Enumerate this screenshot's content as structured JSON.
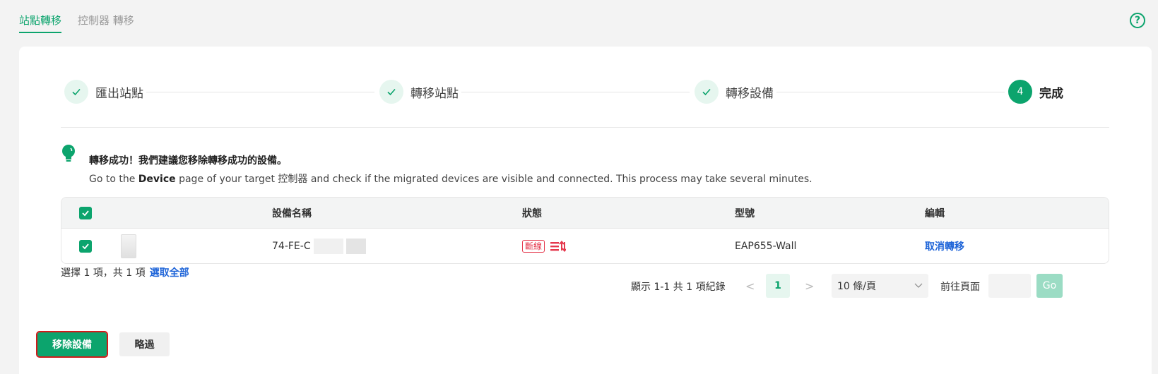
{
  "tabs": [
    {
      "label": "站點轉移",
      "active": true
    },
    {
      "label": "控制器 轉移",
      "active": false
    }
  ],
  "help_icon": "?",
  "steps": [
    {
      "label": "匯出站點",
      "state": "done"
    },
    {
      "label": "轉移站點",
      "state": "done"
    },
    {
      "label": "轉移設備",
      "state": "done"
    },
    {
      "label": "完成",
      "number": "4",
      "state": "current"
    }
  ],
  "tip": {
    "title": "轉移成功！我們建議您移除轉移成功的設備。",
    "desc_before": "Go to the ",
    "desc_bold": "Device",
    "desc_after": " page of your target 控制器 and check if the migrated devices are visible and connected. This process may take several minutes."
  },
  "table": {
    "headers": [
      "設備名稱",
      "狀態",
      "型號",
      "編輯"
    ],
    "rows": [
      {
        "name": "74-FE-C",
        "status": "斷線",
        "model": "EAP655-Wall",
        "action": "取消轉移"
      }
    ]
  },
  "selection": {
    "text": "選擇 1 項，共 1 項",
    "select_all": "選取全部"
  },
  "pagination": {
    "total": "顯示 1-1 共 1 項紀錄",
    "prev": "<",
    "page": "1",
    "next": ">",
    "per_page": "10 條/頁",
    "goto_label": "前往頁面",
    "go": "Go"
  },
  "buttons": {
    "remove": "移除設備",
    "skip": "略過"
  },
  "colors": {
    "accent": "#0ca46d",
    "danger": "#e5384d",
    "link": "#1e64d8"
  }
}
